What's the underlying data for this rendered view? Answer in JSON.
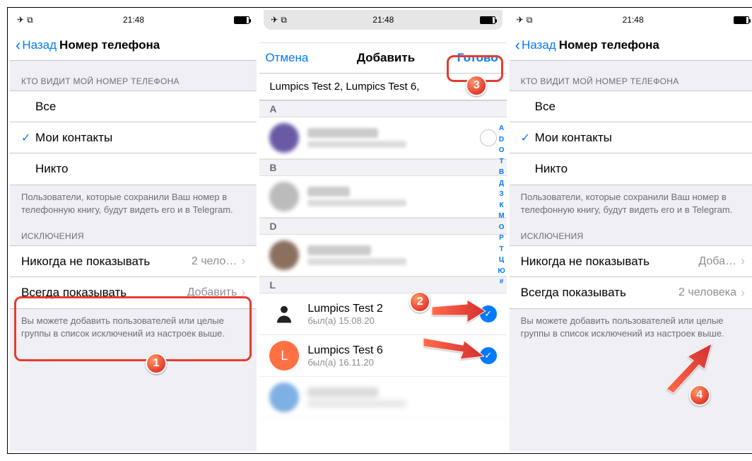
{
  "statusbar": {
    "time": "21:48"
  },
  "screen1": {
    "back": "Назад",
    "title": "Номер телефона",
    "section_who": "КТО ВИДИТ МОЙ НОМЕР ТЕЛЕФОНА",
    "opt_all": "Все",
    "opt_contacts": "Мои контакты",
    "opt_nobody": "Никто",
    "who_footer": "Пользователи, которые сохранили Ваш номер в телефонную книгу, будут видеть его и в Telegram.",
    "section_exc": "ИСКЛЮЧЕНИЯ",
    "never_show": "Никогда не показывать",
    "never_val": "2 чело…",
    "always_show": "Всегда показывать",
    "always_val": "Добавить",
    "exc_footer": "Вы можете добавить пользователей или целые группы в список исключений из настроек выше."
  },
  "screen2": {
    "cancel": "Отмена",
    "title": "Добавить",
    "done": "Готово",
    "selected": "Lumpics Test 2,  Lumpics Test 6,",
    "hdr_a": "A",
    "hdr_b": "B",
    "hdr_d": "D",
    "hdr_l": "L",
    "c1_avatar": "",
    "c1_color": "#6a5aa6",
    "c2_avatar": "",
    "c2_color": "#9b9b9b",
    "c3_avatar": "",
    "c3_color": "#8b7060",
    "c4_name": "Lumpics Test 2",
    "c4_sub": "был(а) 15.08.20",
    "c5_name": "Lumpics Test 6",
    "c5_sub": "был(а) 16.11.20",
    "c5_avatar": "L",
    "c5_color": "#ff7043",
    "index_letters": [
      "A",
      "D",
      "O",
      "T",
      "В",
      "Д",
      "З",
      "К",
      "М",
      "О",
      "Р",
      "Т",
      "Ц",
      "Ю",
      "#"
    ]
  },
  "screen3": {
    "back": "Назад",
    "title": "Номер телефона",
    "section_who": "КТО ВИДИТ МОЙ НОМЕР ТЕЛЕФОНА",
    "opt_all": "Все",
    "opt_contacts": "Мои контакты",
    "opt_nobody": "Никто",
    "who_footer": "Пользователи, которые сохранили Ваш номер в телефонную книгу, будут видеть его и в Telegram.",
    "section_exc": "ИСКЛЮЧЕНИЯ",
    "never_show": "Никогда не показывать",
    "never_val": "Доба…",
    "always_show": "Всегда показывать",
    "always_val": "2 человека",
    "exc_footer": "Вы можете добавить пользователей или целые группы в список исключений из настроек выше."
  },
  "badges": {
    "b1": "1",
    "b2": "2",
    "b3": "3",
    "b4": "4"
  }
}
